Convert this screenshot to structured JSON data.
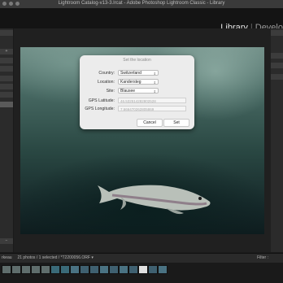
{
  "window": {
    "title": "Lightroom Catalog-v13-3.lrcat - Adobe Photoshop Lightroom Classic - Library"
  },
  "modules": {
    "active": "Library",
    "next": "Develo",
    "separator": "|"
  },
  "dialog": {
    "title": "Set the location",
    "country_label": "Country:",
    "country_value": "Switzerland",
    "location_label": "Location:",
    "location_value": "Kandersteg",
    "site_label": "Site:",
    "site_value": "Blausee",
    "lat_label": "GPS Latitude:",
    "lat_value": "46.532514282802528",
    "lon_label": "GPS Longitude:",
    "lon_value": "7.666470262805869",
    "cancel_label": "Cancel",
    "set_label": "Set"
  },
  "statusbar": {
    "left_text": "rkeau",
    "info_text": "21 photos / 1 selected / *T2200056.ORF",
    "chevron": "▾",
    "filter_label": "Filter :"
  },
  "leftpanel": {
    "plus": "+",
    "minus": "−"
  }
}
